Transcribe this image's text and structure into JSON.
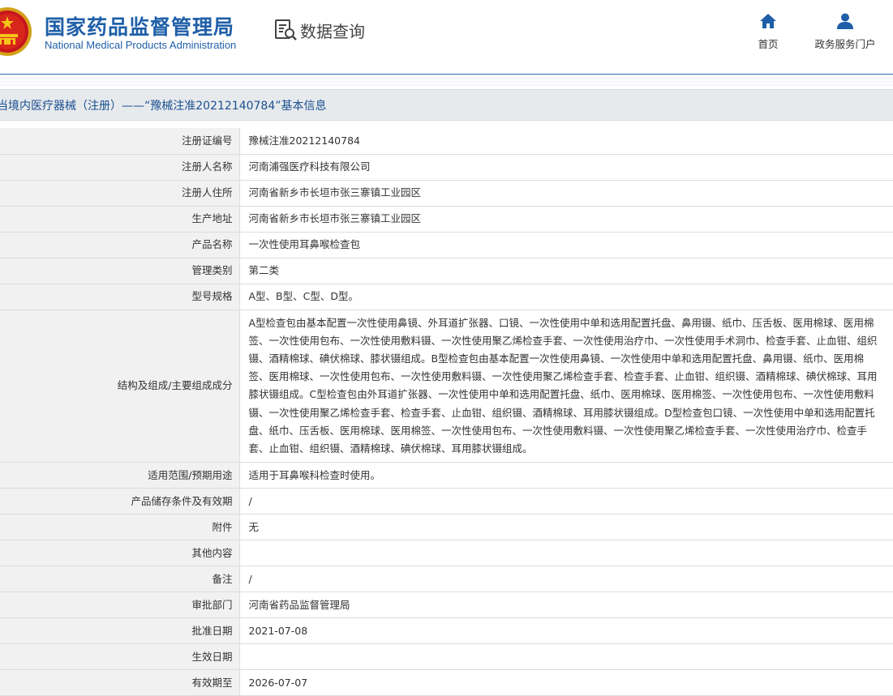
{
  "header": {
    "agency_name_cn": "国家药品监督管理局",
    "agency_name_en": "National Medical Products Administration",
    "data_query_label": "数据查询",
    "nav": [
      {
        "label": "首页",
        "icon": "home-icon"
      },
      {
        "label": "政务服务门户",
        "icon": "user-icon"
      }
    ]
  },
  "title_bar": {
    "text": "当境内医疗器械（注册）——“豫械注准20212140784”基本信息"
  },
  "colors": {
    "brand_blue": "#1f5fa8",
    "title_bg": "#e7eaed",
    "label_bg": "#f1f1f1"
  },
  "rows": [
    {
      "label": "注册证编号",
      "value": "豫械注准20212140784"
    },
    {
      "label": "注册人名称",
      "value": "河南浦强医疗科技有限公司"
    },
    {
      "label": "注册人住所",
      "value": "河南省新乡市长垣市张三寨镇工业园区"
    },
    {
      "label": "生产地址",
      "value": "河南省新乡市长垣市张三寨镇工业园区"
    },
    {
      "label": "产品名称",
      "value": "一次性使用耳鼻喉检查包"
    },
    {
      "label": "管理类别",
      "value": "第二类"
    },
    {
      "label": "型号规格",
      "value": "A型、B型、C型、D型。"
    },
    {
      "label": "结构及组成/主要组成成分",
      "value": "A型检查包由基本配置一次性使用鼻镜、外耳道扩张器、口镜、一次性使用中单和选用配置托盘、鼻用镊、纸巾、压舌板、医用棉球、医用棉签、一次性使用包布、一次性使用敷料镊、一次性使用聚乙烯检查手套、一次性使用治疗巾、一次性使用手术洞巾、检查手套、止血钳、组织镊、酒精棉球、碘伏棉球、膝状镊组成。B型检查包由基本配置一次性使用鼻镜、一次性使用中单和选用配置托盘、鼻用镊、纸巾、医用棉签、医用棉球、一次性使用包布、一次性使用敷料镊、一次性使用聚乙烯检查手套、检查手套、止血钳、组织镊、酒精棉球、碘伏棉球、耳用膝状镊组成。C型检查包由外耳道扩张器、一次性使用中单和选用配置托盘、纸巾、医用棉球、医用棉签、一次性使用包布、一次性使用敷料镊、一次性使用聚乙烯检查手套、检查手套、止血钳、组织镊、酒精棉球、耳用膝状镊组成。D型检查包口镜、一次性使用中单和选用配置托盘、纸巾、压舌板、医用棉球、医用棉签、一次性使用包布、一次性使用敷料镊、一次性使用聚乙烯检查手套、一次性使用治疗巾、检查手套、止血钳、组织镊、酒精棉球、碘伏棉球、耳用膝状镊组成。"
    },
    {
      "label": "适用范围/预期用途",
      "value": "适用于耳鼻喉科检查时使用。"
    },
    {
      "label": "产品储存条件及有效期",
      "value": "/"
    },
    {
      "label": "附件",
      "value": "无"
    },
    {
      "label": "其他内容",
      "value": ""
    },
    {
      "label": "备注",
      "value": "/"
    },
    {
      "label": "审批部门",
      "value": "河南省药品监督管理局"
    },
    {
      "label": "批准日期",
      "value": "2021-07-08"
    },
    {
      "label": "生效日期",
      "value": ""
    },
    {
      "label": "有效期至",
      "value": "2026-07-07"
    }
  ]
}
